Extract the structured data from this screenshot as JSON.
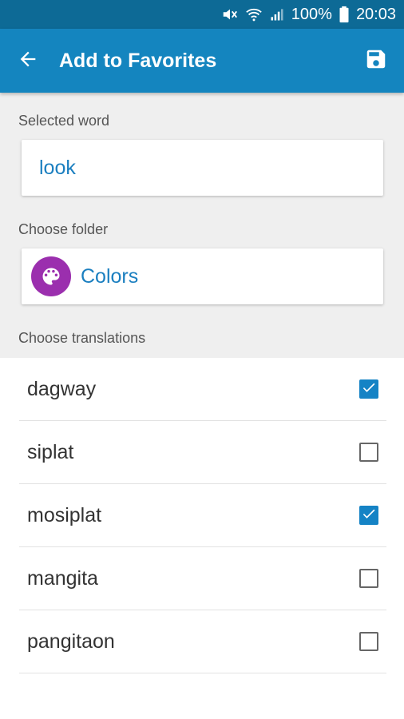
{
  "status_bar": {
    "battery": "100%",
    "time": "20:03",
    "icons": [
      "mute-icon",
      "wifi-icon",
      "signal-icon",
      "battery-icon"
    ]
  },
  "app_bar": {
    "title": "Add to Favorites",
    "back_icon": "arrow-back-icon",
    "save_icon": "save-icon"
  },
  "selected_word": {
    "label": "Selected word",
    "value": "look"
  },
  "folder": {
    "label": "Choose folder",
    "name": "Colors",
    "icon": "palette-icon",
    "icon_color": "#9b2fae"
  },
  "translations": {
    "label": "Choose translations",
    "items": [
      {
        "text": "dagway",
        "checked": true
      },
      {
        "text": "siplat",
        "checked": false
      },
      {
        "text": "mosiplat",
        "checked": true
      },
      {
        "text": "mangita",
        "checked": false
      },
      {
        "text": "pangitaon",
        "checked": false
      }
    ]
  },
  "colors": {
    "status_bar": "#0d6a96",
    "app_bar": "#1485bf",
    "accent": "#1583c5"
  }
}
